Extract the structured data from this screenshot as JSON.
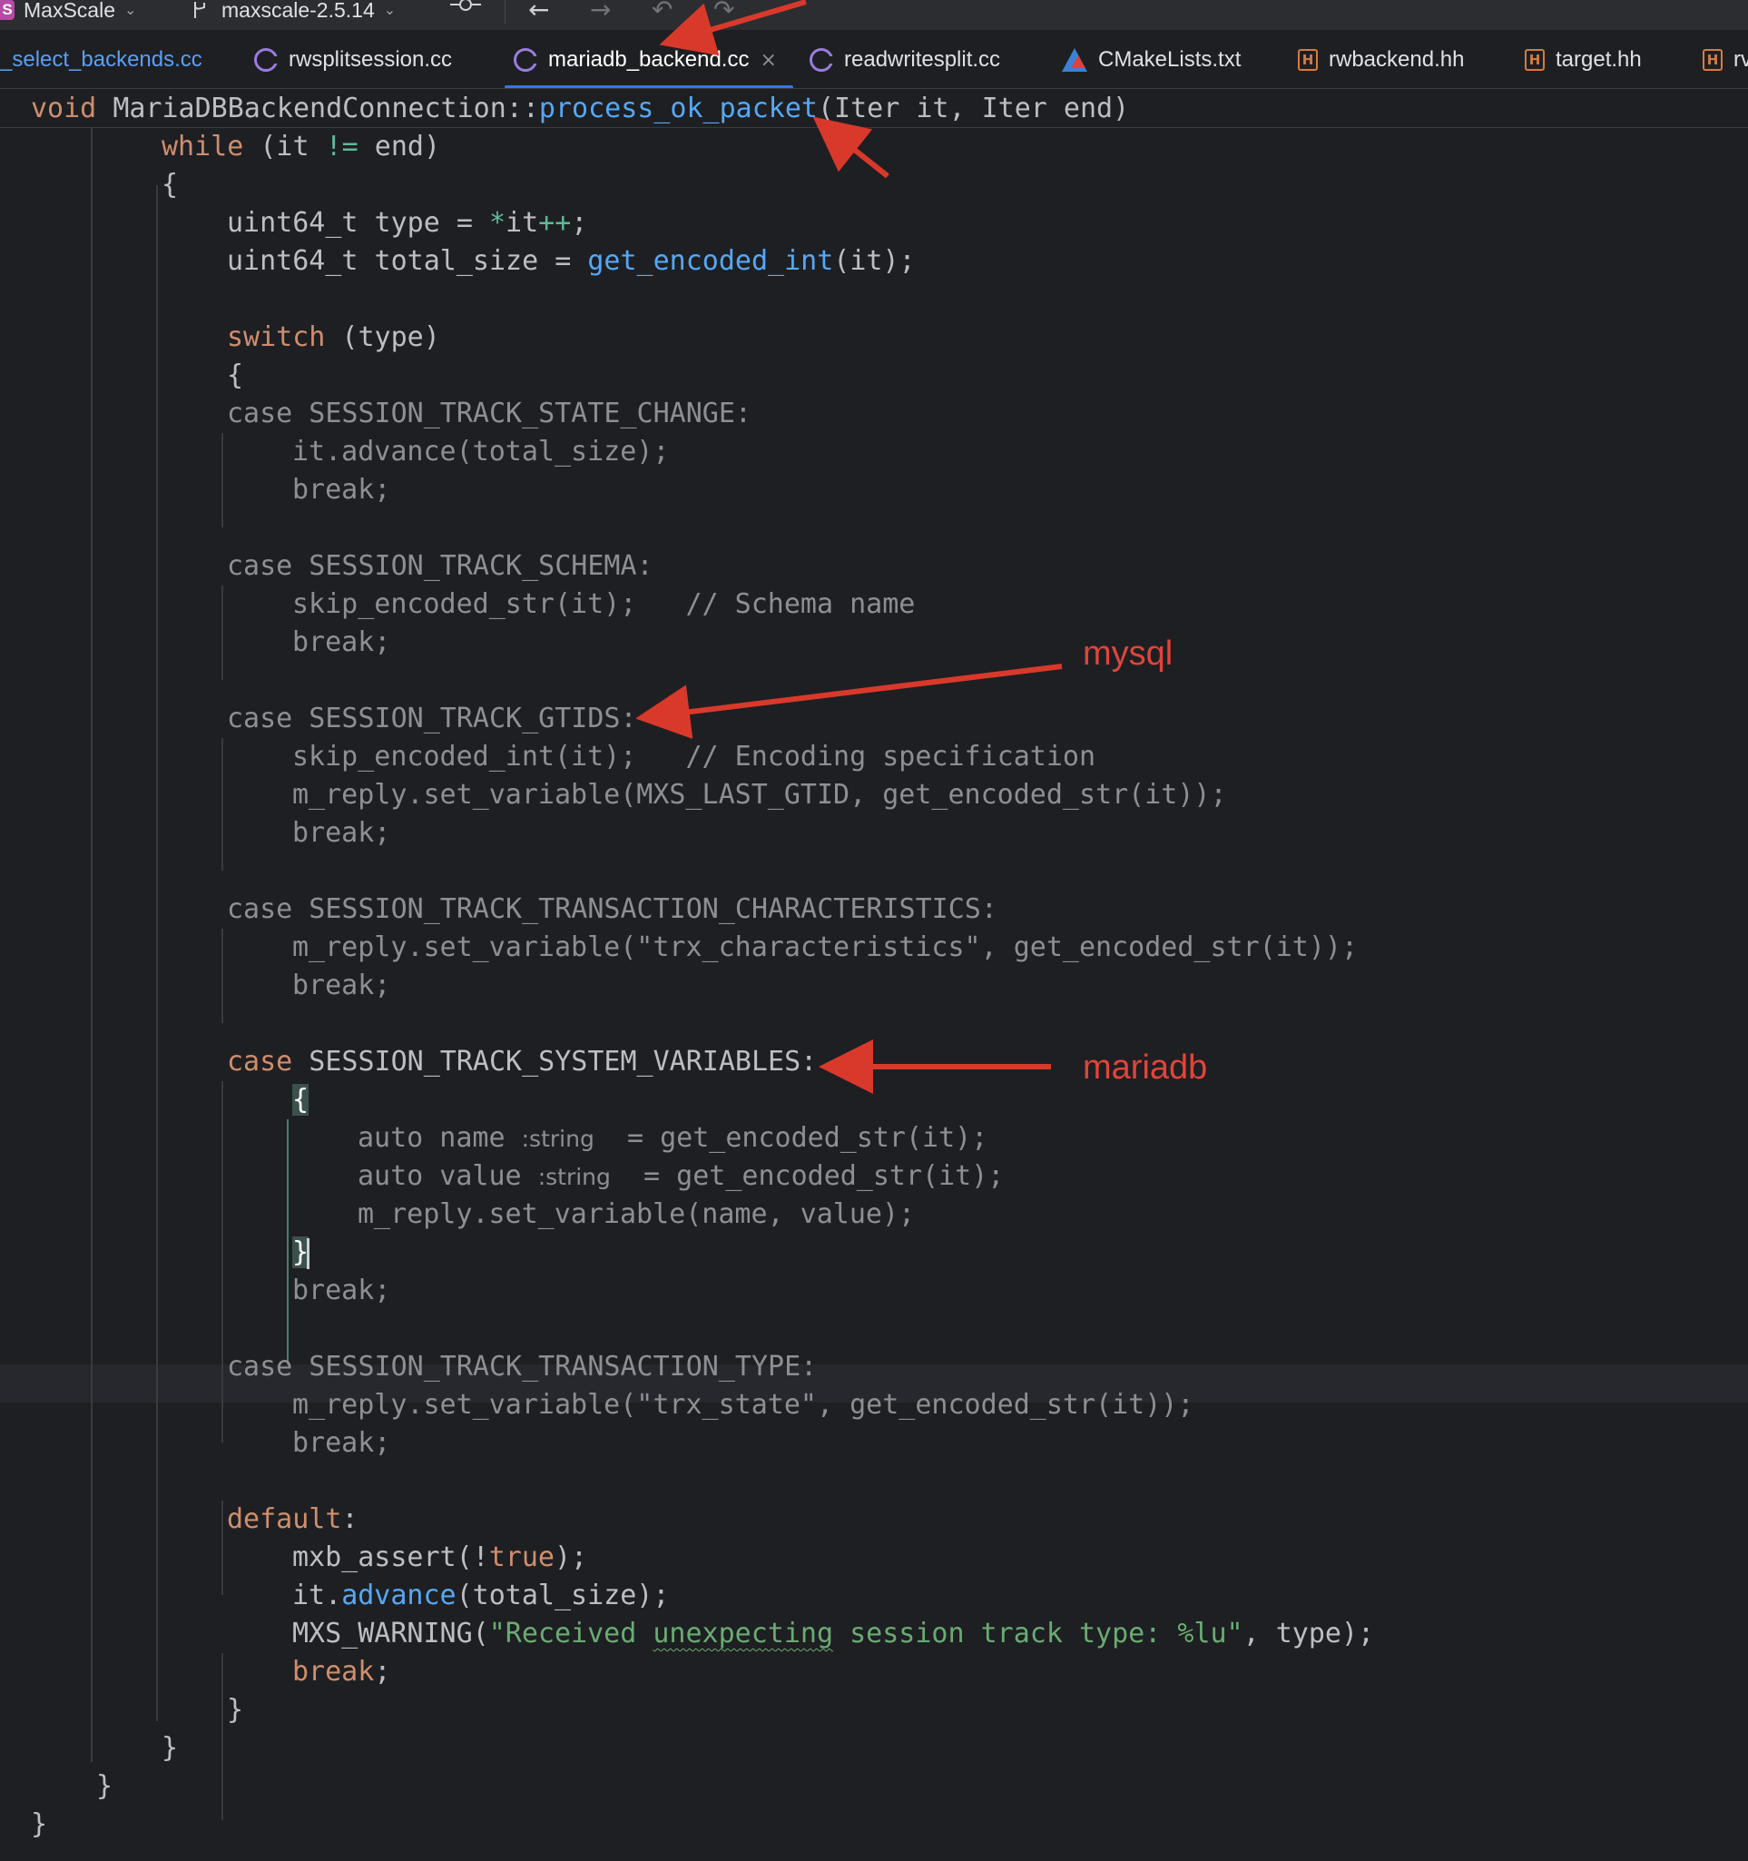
{
  "toolbar": {
    "project_badge": "S",
    "project": "MaxScale",
    "branch": "maxscale-2.5.14"
  },
  "tabs": [
    {
      "label": "_select_backends.cc",
      "icon": "cpp-file-icon",
      "state": "partial"
    },
    {
      "label": "rwsplitsession.cc",
      "icon": "cpp-file-icon"
    },
    {
      "label": "mariadb_backend.cc",
      "icon": "cpp-file-icon",
      "state": "active",
      "close": "×"
    },
    {
      "label": "readwritesplit.cc",
      "icon": "cpp-file-icon"
    },
    {
      "label": "CMakeLists.txt",
      "icon": "cmake-file-icon"
    },
    {
      "label": "rwbackend.hh",
      "icon": "header-file-icon"
    },
    {
      "label": "target.hh",
      "icon": "header-file-icon"
    },
    {
      "label": "rv",
      "icon": "header-file-icon",
      "state": "partial"
    }
  ],
  "header_icon_letter": "H",
  "sticky": {
    "kw": "void",
    "cls": "MariaDBBackendConnection",
    "sep": "::",
    "fn": "process_ok_packet",
    "params": "(Iter it, Iter end)"
  },
  "code": {
    "l1": {
      "kw": "while",
      "rest": " (it ",
      "op": "!=",
      "rest2": " end)"
    },
    "l2": "{",
    "l3": {
      "pre": "uint64_t type = ",
      "op": "*",
      "mid": "it",
      "op2": "++",
      "post": ";"
    },
    "l4": {
      "pre": "uint64_t total_size = ",
      "fn": "get_encoded_int",
      "post": "(it);"
    },
    "l6": {
      "kw": "switch",
      "rest": " (type)"
    },
    "l7": "{",
    "l8": "case SESSION_TRACK_STATE_CHANGE:",
    "l9": "it.advance(total_size);",
    "l10": "break;",
    "l12": "case SESSION_TRACK_SCHEMA:",
    "l13": "skip_encoded_str(it);   // Schema name",
    "l14": "break;",
    "l16": "case SESSION_TRACK_GTIDS:",
    "l17": "skip_encoded_int(it);   // Encoding specification",
    "l18": "m_reply.set_variable(MXS_LAST_GTID, get_encoded_str(it));",
    "l19": "break;",
    "l21": "case SESSION_TRACK_TRANSACTION_CHARACTERISTICS:",
    "l22": "m_reply.set_variable(\"trx_characteristics\", get_encoded_str(it));",
    "l23": "break;",
    "l25": {
      "kw": "case",
      "rest": " SESSION_TRACK_SYSTEM_VARIABLES:"
    },
    "l26": "{",
    "l27": {
      "pre": "auto name ",
      "hint": ":string",
      "post": "  = get_encoded_str(it);"
    },
    "l28": {
      "pre": "auto value ",
      "hint": ":string",
      "post": "  = get_encoded_str(it);"
    },
    "l29": "m_reply.set_variable(name, value);",
    "l30": "}",
    "l31": "break;",
    "l33": "case SESSION_TRACK_TRANSACTION_TYPE:",
    "l34": "m_reply.set_variable(\"trx_state\", get_encoded_str(it));",
    "l35": "break;",
    "l37": {
      "kw": "default",
      "rest": ":"
    },
    "l38": {
      "pre": "mxb_assert(!",
      "kw": "true",
      "post": ");"
    },
    "l39": {
      "pre": "it.",
      "fn": "advance",
      "post": "(total_size);"
    },
    "l40": {
      "pre": "MXS_WARNING(",
      "s1": "\"Received ",
      "typo": "unexpecting",
      "s2": " session track type: %lu\"",
      "post": ", type);"
    },
    "l41": {
      "kw": "break",
      "post": ";"
    },
    "l42": "}",
    "l43": "}",
    "l44": "}",
    "l45": "}"
  },
  "annotations": {
    "mysql_label": "mysql",
    "mariadb_label": "mariadb",
    "arrow_color": "#d9392b"
  },
  "colors": {
    "background": "#1e1f22",
    "keyword": "#cf8e6d",
    "function": "#56a8f5",
    "string": "#6aab73",
    "accent": "#3574f0"
  }
}
